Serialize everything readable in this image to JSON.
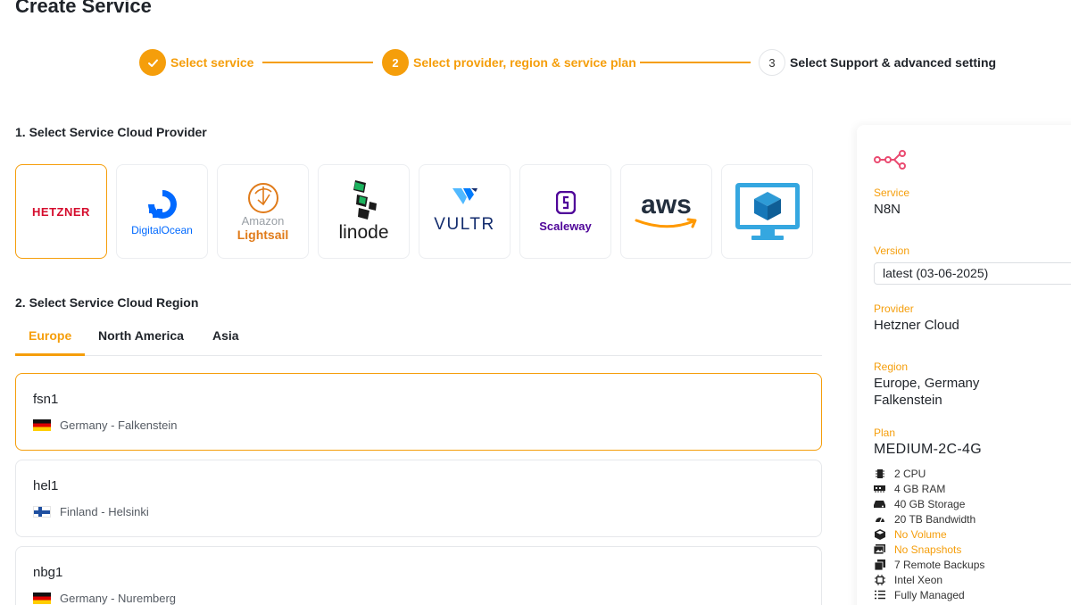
{
  "page": {
    "title": "Create Service"
  },
  "stepper": {
    "steps": [
      {
        "number": "✓",
        "label": "Select service",
        "state": "done"
      },
      {
        "number": "2",
        "label": "Select provider, region & service plan",
        "state": "active"
      },
      {
        "number": "3",
        "label": "Select Support & advanced setting",
        "state": "pending"
      }
    ]
  },
  "providers": {
    "heading": "1. Select Service Cloud Provider",
    "selected": "Hetzner",
    "hetzner_text": "HETZNER",
    "digitalocean_text": "DigitalOcean",
    "lightsail_text_1": "Amazon",
    "lightsail_text_2": "Lightsail",
    "linode_text": "linode",
    "vultr_text": "VULTR",
    "scaleway_text": "Scaleway",
    "aws_text": "aws"
  },
  "regions": {
    "heading": "2. Select Service Cloud Region",
    "tabs": [
      "Europe",
      "North America",
      "Asia"
    ],
    "active_tab": "Europe",
    "items": [
      {
        "code": "fsn1",
        "location": "Germany - Falkenstein",
        "flag": "de",
        "selected": true
      },
      {
        "code": "hel1",
        "location": "Finland - Helsinki",
        "flag": "fi",
        "selected": false
      },
      {
        "code": "nbg1",
        "location": "Germany - Nuremberg",
        "flag": "de",
        "selected": false
      }
    ]
  },
  "summary": {
    "icon": "n8n-logo-icon",
    "service_label": "Service",
    "service_value": "N8N",
    "version_label": "Version",
    "version_value": "latest (03-06-2025)",
    "provider_label": "Provider",
    "provider_value": "Hetzner Cloud",
    "region_label": "Region",
    "region_value_1": "Europe, Germany",
    "region_value_2": "Falkenstein",
    "plan_label": "Plan",
    "plan_value": "MEDIUM-2C-4G",
    "specs": [
      {
        "icon": "cpu-icon",
        "text": "2 CPU",
        "highlight": false
      },
      {
        "icon": "ram-icon",
        "text": "4 GB RAM",
        "highlight": false
      },
      {
        "icon": "storage-icon",
        "text": "40 GB Storage",
        "highlight": false
      },
      {
        "icon": "bandwidth-icon",
        "text": "20 TB Bandwidth",
        "highlight": false
      },
      {
        "icon": "volume-icon",
        "text": "No Volume",
        "highlight": true
      },
      {
        "icon": "snapshot-icon",
        "text": "No Snapshots",
        "highlight": true
      },
      {
        "icon": "backup-icon",
        "text": "7 Remote Backups",
        "highlight": false
      },
      {
        "icon": "processor-icon",
        "text": "Intel Xeon",
        "highlight": false
      },
      {
        "icon": "managed-list-icon",
        "text": "Fully Managed",
        "highlight": false
      }
    ]
  },
  "colors": {
    "accent": "#f59e0b",
    "text": "#1f2329"
  }
}
